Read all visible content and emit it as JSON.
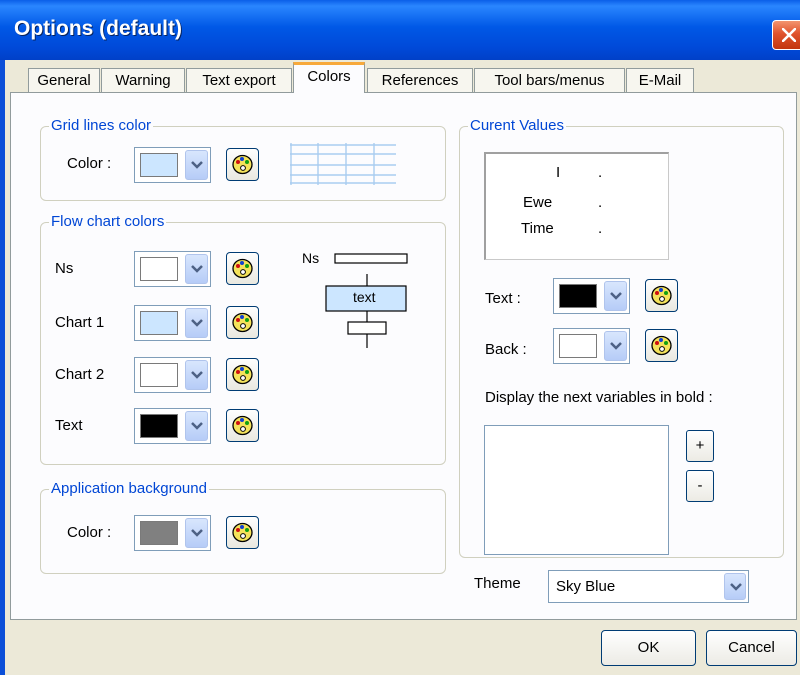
{
  "window": {
    "title": "Options (default)"
  },
  "tabs": [
    {
      "label": "General"
    },
    {
      "label": "Warning"
    },
    {
      "label": "Text export"
    },
    {
      "label": "Colors"
    },
    {
      "label": "References"
    },
    {
      "label": "Tool bars/menus"
    },
    {
      "label": "E-Mail"
    }
  ],
  "active_tab": "Colors",
  "grid_lines": {
    "legend": "Grid lines color",
    "color_label": "Color :",
    "color": "#cce6ff"
  },
  "flow_chart": {
    "legend": "Flow chart colors",
    "rows": [
      {
        "label": "Ns",
        "color": "#ffffff"
      },
      {
        "label": "Chart 1",
        "color": "#cce6ff"
      },
      {
        "label": "Chart 2",
        "color": "#ffffff"
      },
      {
        "label": "Text",
        "color": "#000000"
      }
    ],
    "preview": {
      "ns_label": "Ns",
      "box_text": "text"
    }
  },
  "app_background": {
    "legend": "Application background",
    "color_label": "Color :",
    "color": "#808080"
  },
  "current_values": {
    "legend": "Curent Values",
    "items": [
      {
        "name": "I",
        "value": "."
      },
      {
        "name": "Ewe",
        "value": "."
      },
      {
        "name": "Time",
        "value": "."
      }
    ],
    "text_label": "Text :",
    "text_color": "#000000",
    "back_label": "Back :",
    "back_color": "#ffffff",
    "bold_label": "Display the next variables in bold :",
    "plus_label": "+",
    "minus_label": "-"
  },
  "theme": {
    "label": "Theme",
    "value": "Sky Blue"
  },
  "buttons": {
    "ok": "OK",
    "cancel": "Cancel"
  },
  "colors": {
    "title_bar": "#0058e6",
    "legend_text": "#0046d5",
    "active_tab_accent": "#f7a93b"
  },
  "icons": {
    "palette": "palette-icon",
    "dropdown": "chevron-down-icon",
    "close": "close-icon"
  }
}
